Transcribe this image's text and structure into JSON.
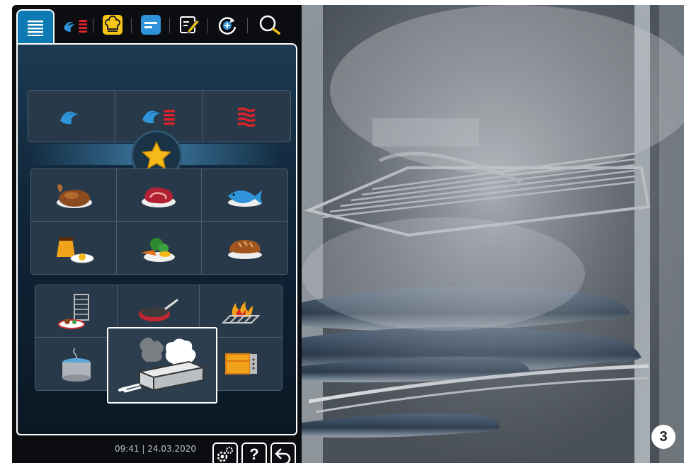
{
  "tabs": [
    {
      "name": "menu"
    },
    {
      "name": "cooking-modes"
    },
    {
      "name": "intelligent-cooking"
    },
    {
      "name": "programs"
    },
    {
      "name": "edit"
    },
    {
      "name": "icombi"
    },
    {
      "name": "search"
    }
  ],
  "footer": {
    "time": "09:41",
    "separator": "|",
    "date": "24.03.2020",
    "help_label": "?"
  },
  "step_badge": "3",
  "colors": {
    "accent_blue": "#0e7ab3",
    "steam_blue": "#3aa0e0",
    "heat_red": "#d8232a",
    "star_yellow": "#f6b91a",
    "tab_yellow": "#f5c518"
  }
}
